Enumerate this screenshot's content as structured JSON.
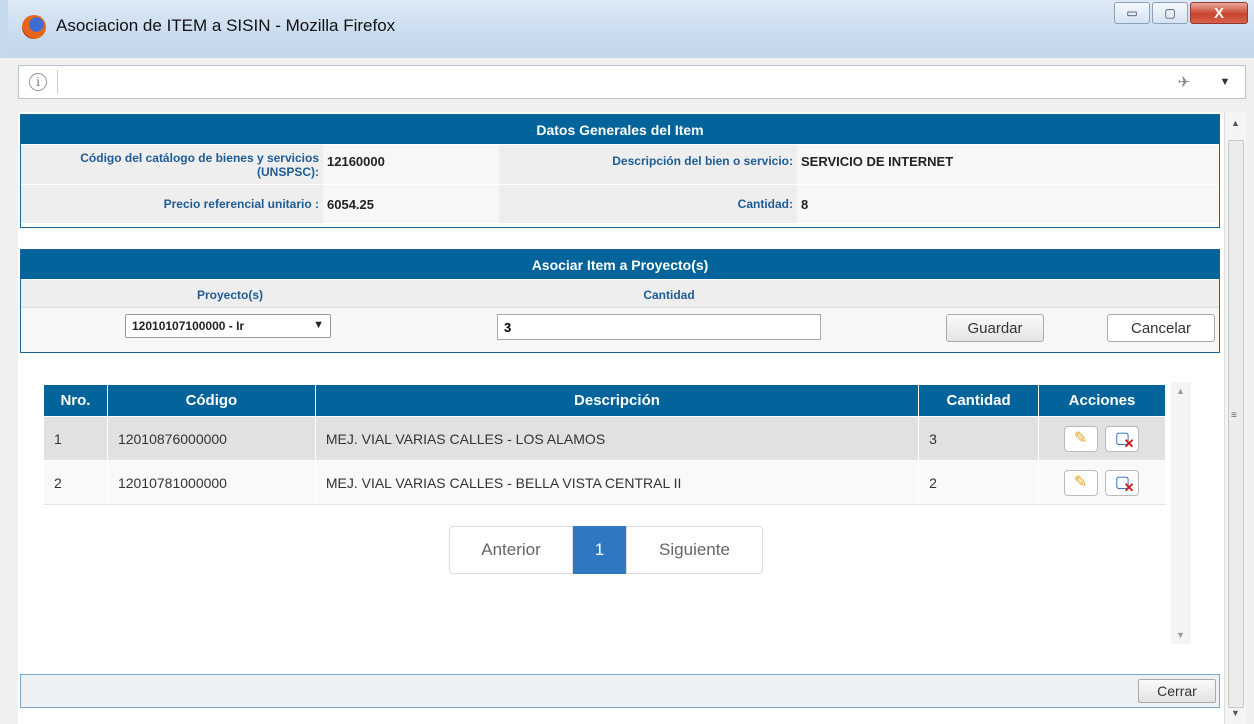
{
  "window": {
    "title": "Asociacion de ITEM a SISIN - Mozilla Firefox",
    "minimize_glyph": "▭",
    "maximize_glyph": "▢",
    "close_glyph": "X"
  },
  "urlbar": {
    "value": "",
    "info_glyph": "i"
  },
  "datos_generales": {
    "header": "Datos Generales del Item",
    "codigo_label": "Código del catálogo de bienes y servicios (UNSPSC):",
    "codigo_value": "12160000",
    "descripcion_label": "Descripción del bien o servicio:",
    "descripcion_value": "SERVICIO DE INTERNET",
    "precio_label": "Precio referencial unitario :",
    "precio_value": "6054.25",
    "cantidad_label": "Cantidad:",
    "cantidad_value": "8"
  },
  "asociar": {
    "header": "Asociar Item a Proyecto(s)",
    "proyecto_label": "Proyecto(s)",
    "cantidad_label": "Cantidad",
    "proyecto_selected": "12010107100000 - Ir",
    "cantidad_value": "3",
    "guardar_label": "Guardar",
    "cancelar_label": "Cancelar"
  },
  "table": {
    "headers": [
      "Nro.",
      "Código",
      "Descripción",
      "Cantidad",
      "Acciones"
    ],
    "rows": [
      {
        "nro": "1",
        "codigo": "12010876000000",
        "descripcion": "MEJ. VIAL VARIAS CALLES - LOS ALAMOS",
        "cantidad": "3"
      },
      {
        "nro": "2",
        "codigo": "12010781000000",
        "descripcion": "MEJ. VIAL VARIAS CALLES - BELLA VISTA CENTRAL II",
        "cantidad": "2"
      }
    ]
  },
  "pagination": {
    "prev": "Anterior",
    "current": "1",
    "next": "Siguiente"
  },
  "footer": {
    "cerrar_label": "Cerrar"
  },
  "icons": {
    "edit": "pencil-icon",
    "delete": "delete-file-icon"
  },
  "colors": {
    "header_blue": "#02649a",
    "label_blue": "#1d5c95",
    "page_active": "#2e78c2"
  }
}
